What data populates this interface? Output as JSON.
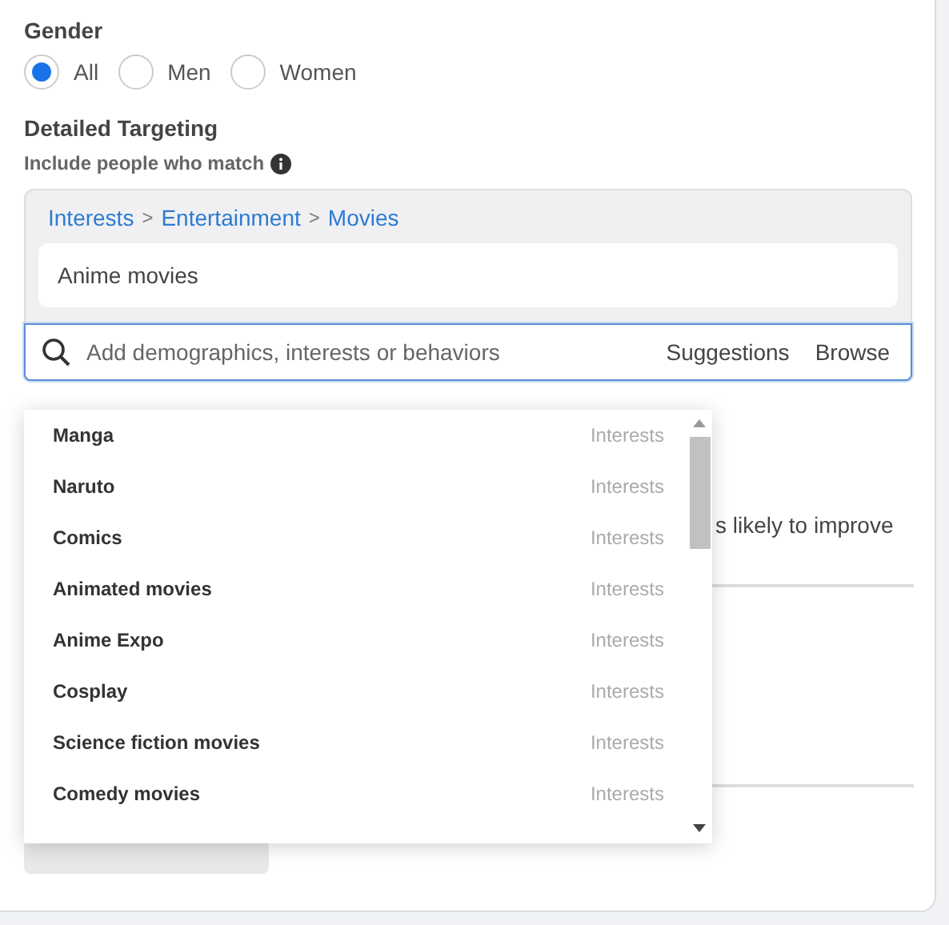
{
  "gender": {
    "label": "Gender",
    "options": [
      {
        "label": "All",
        "selected": true
      },
      {
        "label": "Men",
        "selected": false
      },
      {
        "label": "Women",
        "selected": false
      }
    ]
  },
  "targeting": {
    "title": "Detailed Targeting",
    "subtitle": "Include people who match",
    "breadcrumb": [
      {
        "label": "Interests"
      },
      {
        "label": "Entertainment"
      },
      {
        "label": "Movies"
      }
    ],
    "breadcrumb_separator": ">",
    "selected_items": [
      "Anime movies"
    ],
    "search": {
      "placeholder": "Add demographics, interests or behaviors",
      "actions": [
        "Suggestions",
        "Browse"
      ]
    }
  },
  "behind_text": "s likely to improve",
  "dropdown": [
    {
      "name": "Manga",
      "category": "Interests"
    },
    {
      "name": "Naruto",
      "category": "Interests"
    },
    {
      "name": "Comics",
      "category": "Interests"
    },
    {
      "name": "Animated movies",
      "category": "Interests"
    },
    {
      "name": "Anime Expo",
      "category": "Interests"
    },
    {
      "name": "Cosplay",
      "category": "Interests"
    },
    {
      "name": "Science fiction movies",
      "category": "Interests"
    },
    {
      "name": "Comedy movies",
      "category": "Interests"
    }
  ]
}
